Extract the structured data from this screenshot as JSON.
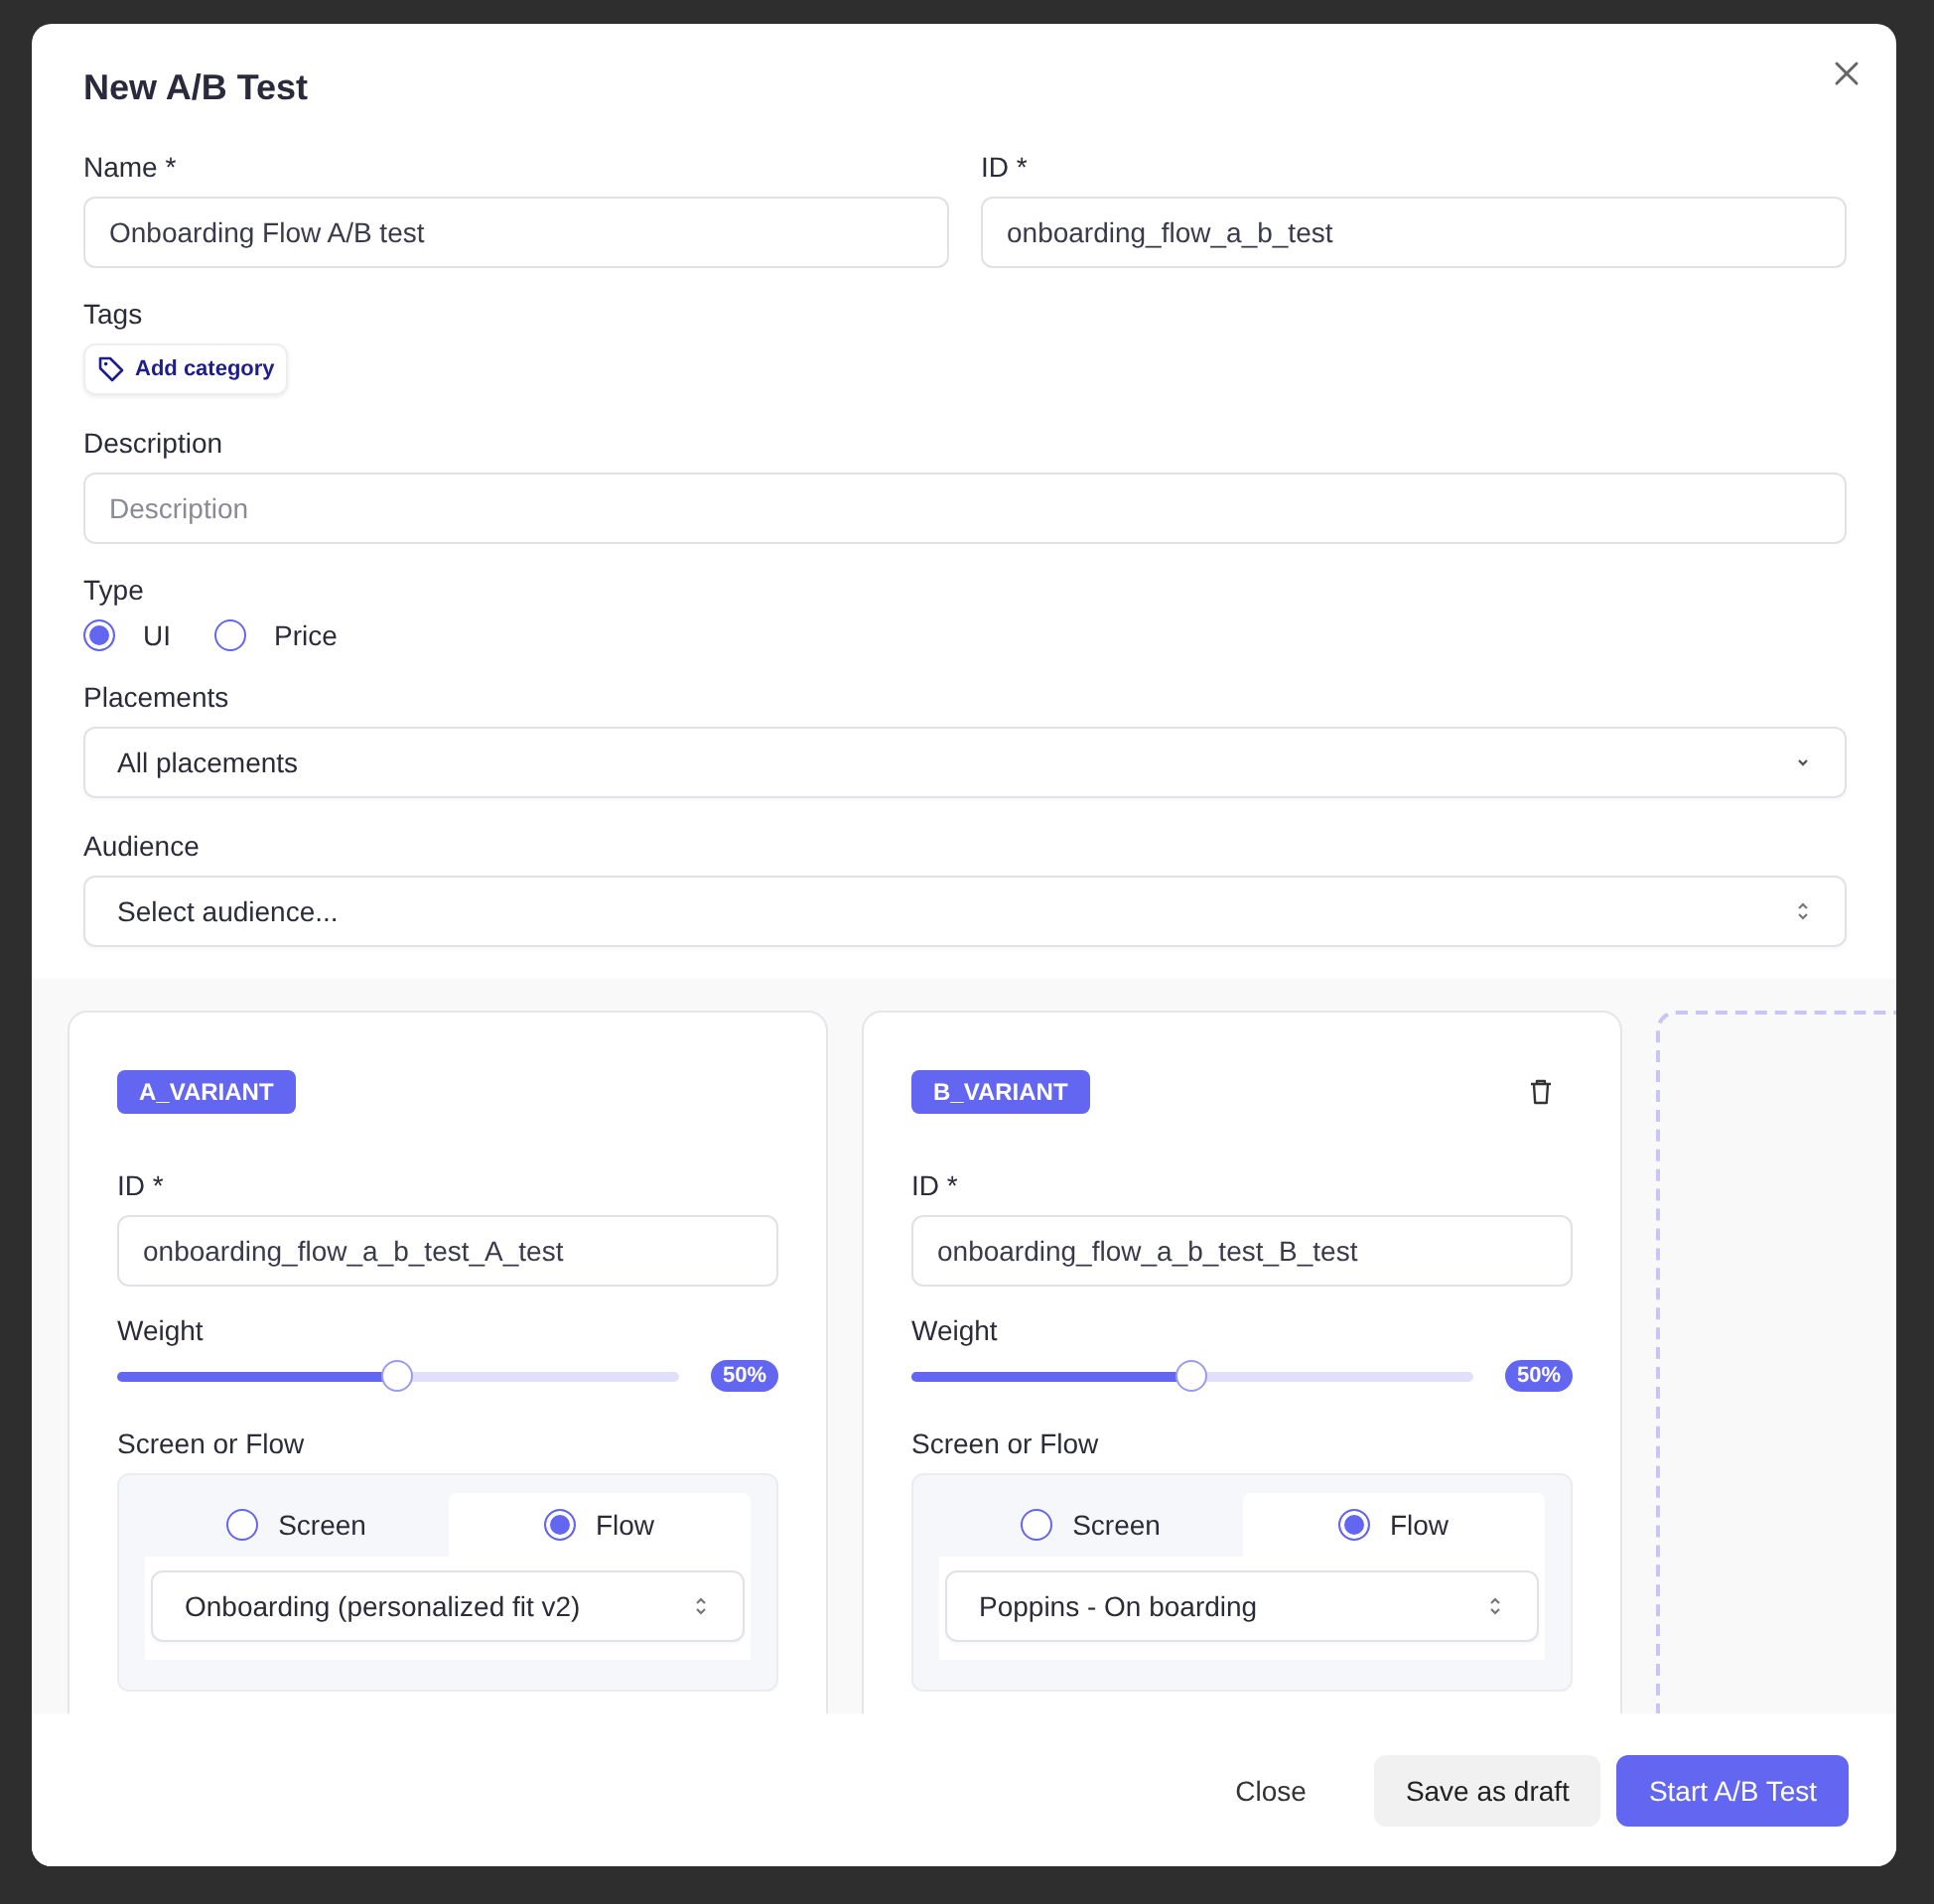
{
  "dialog": {
    "title": "New A/B Test",
    "name": {
      "label": "Name *",
      "value": "Onboarding Flow A/B test"
    },
    "id": {
      "label": "ID *",
      "value": "onboarding_flow_a_b_test"
    },
    "tags": {
      "label": "Tags",
      "button": "Add category"
    },
    "description": {
      "label": "Description",
      "placeholder": "Description"
    },
    "type": {
      "label": "Type",
      "options": [
        {
          "label": "UI",
          "selected": true
        },
        {
          "label": "Price",
          "selected": false
        }
      ]
    },
    "placements": {
      "label": "Placements",
      "value": "All placements"
    },
    "audience": {
      "label": "Audience",
      "value": "Select audience..."
    },
    "variants": [
      {
        "tag": "A_VARIANT",
        "deletable": false,
        "id_label": "ID *",
        "id_value": "onboarding_flow_a_b_test_A_test",
        "weight_label": "Weight",
        "level": 0.5,
        "reading": "50%",
        "source_label": "Screen or Flow",
        "options": [
          {
            "label": "Screen",
            "selected": false
          },
          {
            "label": "Flow",
            "selected": true
          }
        ],
        "flow_value": "Onboarding (personalized fit v2)"
      },
      {
        "tag": "B_VARIANT",
        "deletable": true,
        "id_label": "ID *",
        "id_value": "onboarding_flow_a_b_test_B_test",
        "weight_label": "Weight",
        "level": 0.5,
        "reading": "50%",
        "source_label": "Screen or Flow",
        "options": [
          {
            "label": "Screen",
            "selected": false
          },
          {
            "label": "Flow",
            "selected": true
          }
        ],
        "flow_value": "Poppins - On boarding"
      }
    ],
    "buttons": [
      {
        "label": "Close",
        "kind": "text"
      },
      {
        "label": "Save as draft",
        "kind": "secondary"
      },
      {
        "label": "Start A/B Test",
        "kind": "primary"
      }
    ]
  }
}
